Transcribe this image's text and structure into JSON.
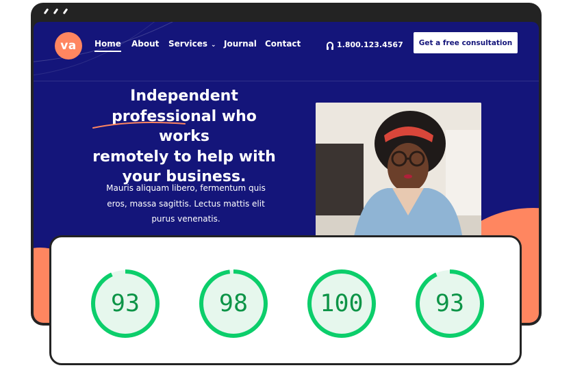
{
  "window": {
    "title_dots": 3
  },
  "nav": {
    "logo_text": "va",
    "items": [
      {
        "label": "Home",
        "active": true
      },
      {
        "label": "About"
      },
      {
        "label": "Services",
        "has_dropdown": true
      },
      {
        "label": "Journal"
      },
      {
        "label": "Contact"
      }
    ],
    "phone_icon": "headphones-icon",
    "phone": "1.800.123.4567",
    "cta_label": "Get a free consultation"
  },
  "hero": {
    "headline_lines": [
      "Independent",
      "professional who works",
      "remotely to help with",
      "your business."
    ],
    "paragraph_lines": [
      "Mauris aliquam libero, fermentum quis",
      "eros, massa sagittis. Lectus mattis elit",
      "purus venenatis."
    ],
    "photo_alt": "woman-working-on-laptop-photo"
  },
  "scores": [
    {
      "value": "93",
      "score": 93
    },
    {
      "value": "98",
      "score": 98
    },
    {
      "value": "100",
      "score": 100
    },
    {
      "value": "93",
      "score": 93
    }
  ],
  "colors": {
    "brand_navy": "#14157a",
    "accent_orange": "#ff8660",
    "score_green": "#0cce6b",
    "score_bg": "#e6f7ed",
    "frame": "#232323"
  }
}
